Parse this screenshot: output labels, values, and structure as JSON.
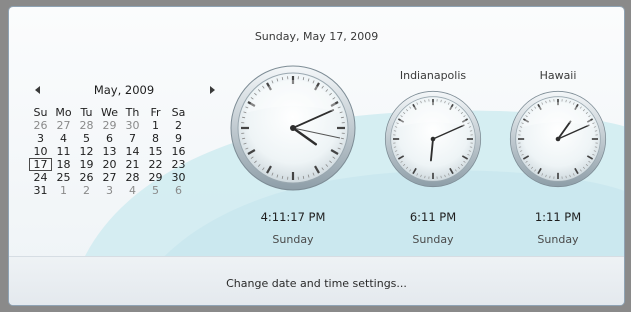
{
  "header": {
    "full_date": "Sunday, May 17, 2009"
  },
  "calendar": {
    "month_label": "May, 2009",
    "prev_icon": "left-arrow-icon",
    "next_icon": "right-arrow-icon",
    "weekdays": [
      "Su",
      "Mo",
      "Tu",
      "We",
      "Th",
      "Fr",
      "Sa"
    ],
    "weeks": [
      [
        "26",
        "27",
        "28",
        "29",
        "30",
        "1",
        "2"
      ],
      [
        "3",
        "4",
        "5",
        "6",
        "7",
        "8",
        "9"
      ],
      [
        "10",
        "11",
        "12",
        "13",
        "14",
        "15",
        "16"
      ],
      [
        "17",
        "18",
        "19",
        "20",
        "21",
        "22",
        "23"
      ],
      [
        "24",
        "25",
        "26",
        "27",
        "28",
        "29",
        "30"
      ],
      [
        "31",
        "1",
        "2",
        "3",
        "4",
        "5",
        "6"
      ]
    ],
    "today": "17"
  },
  "clocks": [
    {
      "name": "",
      "time": "4:11:17 PM",
      "day": "Sunday",
      "hour": 4,
      "minute": 11,
      "second": 17
    },
    {
      "name": "Indianapolis",
      "time": "6:11 PM",
      "day": "Sunday",
      "hour": 6,
      "minute": 11
    },
    {
      "name": "Hawaii",
      "time": "1:11 PM",
      "day": "Sunday",
      "hour": 1,
      "minute": 11
    }
  ],
  "footer": {
    "link": "Change date and time settings..."
  },
  "colors": {
    "accent_wave": "#cfe8ef",
    "footer_bg": "#e8edf1"
  }
}
